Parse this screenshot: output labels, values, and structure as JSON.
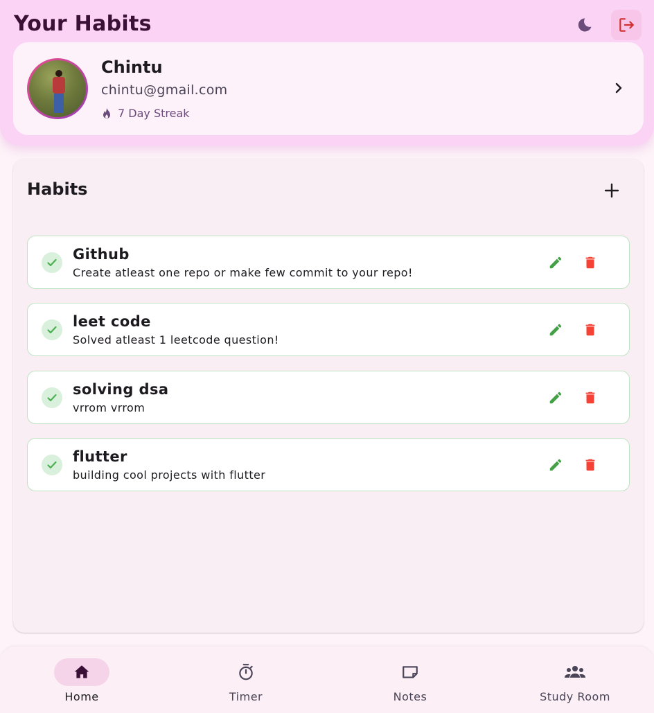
{
  "header": {
    "title": "Your Habits",
    "theme_icon": "moon-icon",
    "logout_icon": "logout-icon"
  },
  "profile": {
    "name": "Chintu",
    "email": "chintu@gmail.com",
    "streak": "7 Day Streak",
    "streak_icon": "flame-icon"
  },
  "habits_section": {
    "title": "Habits",
    "add_icon": "plus-icon",
    "items": [
      {
        "name": "Github",
        "description": "Create atleast one repo or make few commit to your repo!"
      },
      {
        "name": "leet code",
        "description": "Solved atleast 1 leetcode question!"
      },
      {
        "name": "solving dsa",
        "description": "vrrom vrrom"
      },
      {
        "name": "flutter",
        "description": "building cool projects with flutter"
      }
    ]
  },
  "nav": {
    "items": [
      {
        "label": "Home",
        "icon": "home-icon",
        "active": true
      },
      {
        "label": "Timer",
        "icon": "timer-icon",
        "active": false
      },
      {
        "label": "Notes",
        "icon": "notes-icon",
        "active": false
      },
      {
        "label": "Study Room",
        "icon": "group-icon",
        "active": false
      }
    ]
  },
  "colors": {
    "header_bg": "#fbd3f5",
    "check_green": "#4caf50",
    "delete_red": "#f44336",
    "logout_red": "#d32f2f"
  }
}
